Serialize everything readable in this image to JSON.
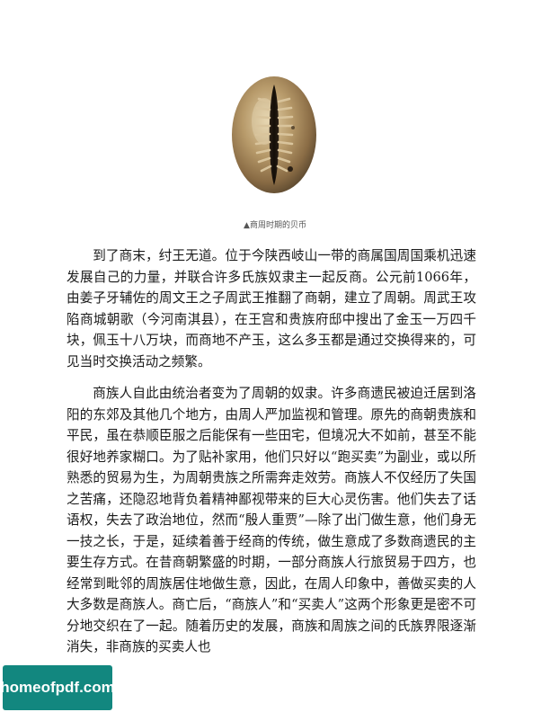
{
  "figure": {
    "caption": "▲商周时期的贝币"
  },
  "paragraphs": [
    "到了商末，纣王无道。位于今陕西岐山一带的商属国周国乘机迅速发展自己的力量，并联合许多氏族奴隶主一起反商。公元前1066年，由姜子牙辅佐的周文王之子周武王推翻了商朝，建立了周朝。周武王攻陷商城朝歌（今河南淇县），在王宫和贵族府邸中搜出了金玉一万四千块，佩玉十八万块，而商地不产玉，这么多玉都是通过交换得来的，可见当时交换活动之频繁。",
    "商族人自此由统治者变为了周朝的奴隶。许多商遗民被迫迁居到洛阳的东郊及其他几个地方，由周人严加监视和管理。原先的商朝贵族和平民，虽在恭顺臣服之后能保有一些田宅，但境况大不如前，甚至不能很好地养家糊口。为了贴补家用，他们只好以“跑买卖”为副业，或以所熟悉的贸易为生，为周朝贵族之所需奔走效劳。商族人不仅经历了失国之苦痛，还隐忍地背负着精神鄙视带来的巨大心灵伤害。他们失去了话语权，失去了政治地位，然而“殷人重贾”—除了出门做生意，他们身无一技之长，于是，延续着善于经商的传统，做生意成了多数商遗民的主要生存方式。在昔商朝繁盛的时期，一部分商族人行旅贸易于四方，也经常到毗邻的周族居住地做生意，因此，在周人印象中，善做买卖的人大多数是商族人。商亡后，“商族人”和“买卖人”这两个形象更是密不可分地交织在了一起。随着历史的发展，商族和周族之间的氏族界限逐渐消失，非商族的买卖人也"
  ],
  "watermark": {
    "text": "homeofpdf.com"
  }
}
